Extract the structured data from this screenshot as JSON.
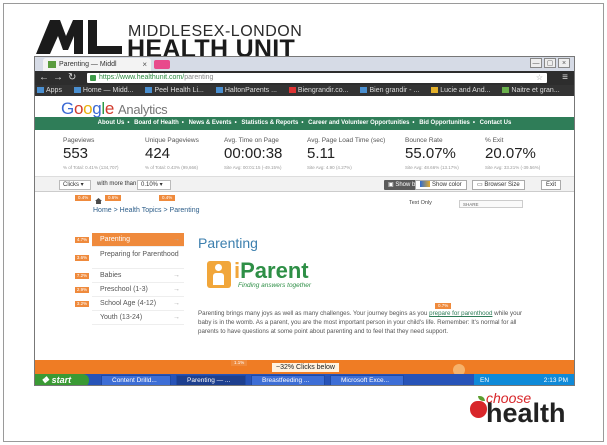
{
  "logo": {
    "mark": "ML",
    "line1": "MIDDLESEX-LONDON",
    "line2": "HEALTH UNIT"
  },
  "browser": {
    "tab_title": "Parenting — Middl",
    "tab_close": "×",
    "url_host": "https://www.healthunit.com/",
    "url_path": "parenting",
    "window_controls": [
      "—",
      "▢",
      "×"
    ],
    "bookmarks": [
      "Apps",
      "Home — Midd...",
      "Peel Health Li...",
      "HaltonParents ...",
      "Biengrandir.co...",
      "Bien grandir - ...",
      "Lucie and And...",
      "Naitre et gran..."
    ]
  },
  "analytics": {
    "brand": "Google",
    "product": "Analytics",
    "site_nav": [
      "About Us",
      "Board of Health",
      "News & Events",
      "Statistics & Reports",
      "Career and Volunteer Opportunities",
      "Bid Opportunities",
      "Contact Us"
    ],
    "metrics": [
      {
        "label": "Pageviews",
        "value": "553",
        "sub": "% of Total: 0.41% (134,707)"
      },
      {
        "label": "Unique Pageviews",
        "value": "424",
        "sub": "% of Total: 0.43% (99,666)"
      },
      {
        "label": "Avg. Time on Page",
        "value": "00:00:38",
        "sub": "Site Avg: 00:01:15 (-49.15%)"
      },
      {
        "label": "Avg. Page Load Time (sec)",
        "value": "5.11",
        "sub": "Site Avg: 4.90 (4.27%)"
      },
      {
        "label": "Bounce Rate",
        "value": "55.07%",
        "sub": "Site Avg: 48.66% (13.17%)"
      },
      {
        "label": "% Exit",
        "value": "20.07%",
        "sub": "Site Avg: 33.21% (-39.56%)"
      }
    ],
    "controls": {
      "metric_select": "Clicks",
      "filter_text": "with more than",
      "threshold_select": "0.10%",
      "show_bubbles": "Show bubbles",
      "show_color": "Show color",
      "browser_size": "Browser Size",
      "exit": "Exit"
    }
  },
  "page": {
    "breadcrumb": "Home > Health Topics > Parenting",
    "text_only": "Text Only",
    "share": "SHARE",
    "top_badges": [
      "0.4%",
      "0.6%",
      "0.4%"
    ],
    "side_items": [
      {
        "label": "Parenting",
        "badge": "4.7%"
      },
      {
        "label": "Preparing for Parenthood",
        "badge": "3.6%"
      },
      {
        "label": "Babies",
        "badge": "7.2%"
      },
      {
        "label": "Preschool (1-3)",
        "badge": "2.9%"
      },
      {
        "label": "School Age (4-12)",
        "badge": "3.2%"
      },
      {
        "label": "Youth (13-24)",
        "badge": ""
      }
    ],
    "title": "Parenting",
    "iparent_i": "i",
    "iparent_rest": "Parent",
    "iparent_tagline": "Finding answers together",
    "body_1": "Parenting brings many joys as well as many challenges. Your journey begins as you ",
    "body_link": "prepare for parenthood",
    "body_2": " while your baby is in the womb. As a parent, you are the most important person in your child's life. Remember: It's normal for all parents to have questions at some point about parenting and to feel that they need support.",
    "body_badge": "0.7%",
    "clicks_below": "~32% Clicks below",
    "clicks_badge": "1.1%"
  },
  "taskbar": {
    "start": "start",
    "tasks": [
      "Content Drilld...",
      "Parenting — ...",
      "Breastfeeding ...",
      "Microsoft Exce..."
    ],
    "tray_lang": "EN",
    "clock": "2:13 PM"
  },
  "footer_logo": {
    "choose": "choose",
    "health": "health"
  }
}
